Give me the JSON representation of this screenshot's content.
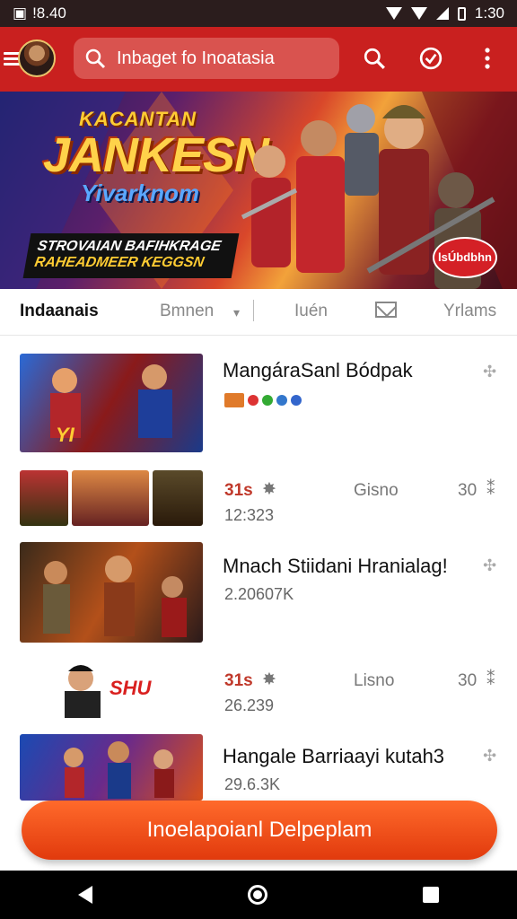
{
  "status_bar": {
    "left_text": "!8.40",
    "time": "1:30"
  },
  "app_bar": {
    "search_placeholder": "Inbaget fo Inoatasia",
    "icons": [
      "menu-icon",
      "avatar",
      "search-icon",
      "badge-icon",
      "more-vert-icon"
    ]
  },
  "banner": {
    "title_small": "KACANTAN",
    "title_big": "JANKESN",
    "subtitle": "Yivarknom",
    "strip_line1": "STROVAIAN BAFIHKRAGE",
    "strip_line2": "RAHEADMEER KEGGSN",
    "badge_text": "lsÚbdbhn"
  },
  "tabs": [
    {
      "label": "Indaanais",
      "active": true
    },
    {
      "label": "Bmnen",
      "active": false
    },
    {
      "label": "Iuén",
      "active": false
    },
    {
      "label": "Yrlams",
      "active": false
    }
  ],
  "list": [
    {
      "title": "MangáraSanl Bódpak",
      "dots": [
        "#e07a2a",
        "#d33",
        "#3a3",
        "#37c",
        "#36c"
      ]
    },
    {
      "stat_left": "31s",
      "stat_mid": "Gisno",
      "stat_right": "30",
      "meta": "12:323"
    },
    {
      "title": "Mnach Stiidani Hranialag!",
      "meta": "2.20607K"
    },
    {
      "stat_left": "31s",
      "stat_mid": "Lisno",
      "stat_right": "30",
      "meta": "26.239"
    },
    {
      "title": "Hangale Barriaayi kutah3",
      "meta": "29.6.3K"
    }
  ],
  "cta_label": "Inoelapoianl Delpeplam",
  "colors": {
    "primary": "#c9201f",
    "cta": "#e8471a"
  }
}
